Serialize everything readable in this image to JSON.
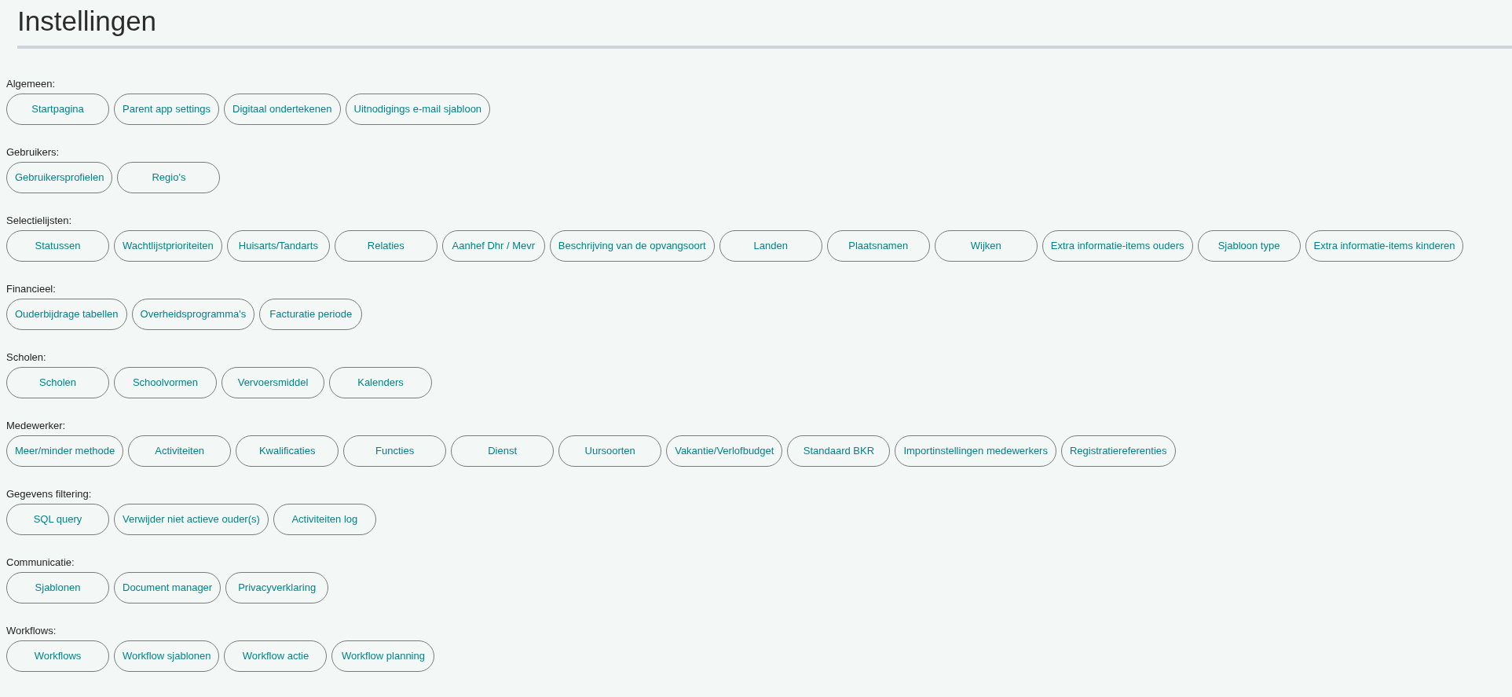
{
  "page": {
    "title": "Instellingen"
  },
  "sections": [
    {
      "label": "Algemeen:",
      "buttons": [
        "Startpagina",
        "Parent app settings",
        "Digitaal ondertekenen",
        "Uitnodigings e-mail sjabloon"
      ]
    },
    {
      "label": "Gebruikers:",
      "buttons": [
        "Gebruikersprofielen",
        "Regio's"
      ]
    },
    {
      "label": "Selectielijsten:",
      "buttons": [
        "Statussen",
        "Wachtlijstprioriteiten",
        "Huisarts/Tandarts",
        "Relaties",
        "Aanhef Dhr / Mevr",
        "Beschrijving van de opvangsoort",
        "Landen",
        "Plaatsnamen",
        "Wijken",
        "Extra informatie-items ouders",
        "Sjabloon type",
        "Extra informatie-items kinderen"
      ]
    },
    {
      "label": "Financieel:",
      "buttons": [
        "Ouderbijdrage tabellen",
        "Overheidsprogramma's",
        "Facturatie periode"
      ]
    },
    {
      "label": "Scholen:",
      "buttons": [
        "Scholen",
        "Schoolvormen",
        "Vervoersmiddel",
        "Kalenders"
      ]
    },
    {
      "label": "Medewerker:",
      "buttons": [
        "Meer/minder methode",
        "Activiteiten",
        "Kwalificaties",
        "Functies",
        "Dienst",
        "Uursoorten",
        "Vakantie/Verlofbudget",
        "Standaard BKR",
        "Importinstellingen medewerkers",
        "Registratiereferenties"
      ]
    },
    {
      "label": "Gegevens filtering:",
      "buttons": [
        "SQL query",
        "Verwijder niet actieve ouder(s)",
        "Activiteiten log"
      ]
    },
    {
      "label": "Communicatie:",
      "buttons": [
        "Sjablonen",
        "Document manager",
        "Privacyverklaring"
      ]
    },
    {
      "label": "Workflows:",
      "buttons": [
        "Workflows",
        "Workflow sjablonen",
        "Workflow actie",
        "Workflow planning"
      ]
    }
  ]
}
